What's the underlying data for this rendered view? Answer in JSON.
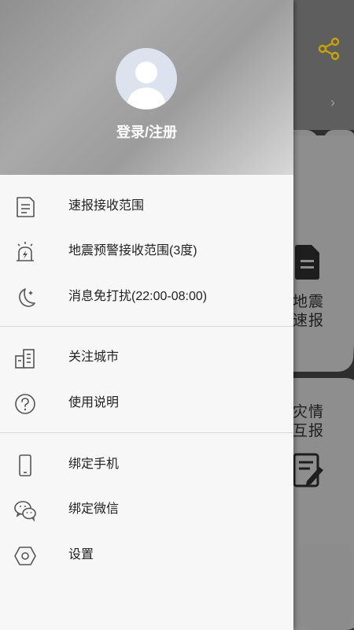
{
  "drawer": {
    "login_label": "登录/注册",
    "menu": [
      {
        "label": "速报接收范围",
        "icon": "document-icon"
      },
      {
        "label": "地震预警接收范围(3度)",
        "icon": "alarm-siren-icon"
      },
      {
        "label": "消息免打扰(22:00-08:00)",
        "icon": "moon-icon"
      },
      {
        "label": "关注城市",
        "icon": "buildings-icon"
      },
      {
        "label": "使用说明",
        "icon": "question-icon"
      },
      {
        "label": "绑定手机",
        "icon": "phone-icon"
      },
      {
        "label": "绑定微信",
        "icon": "wechat-icon"
      },
      {
        "label": "设置",
        "icon": "settings-hexagon-icon"
      }
    ]
  },
  "background": {
    "quake_label": "地震\n速报",
    "disaster_label": "灾情\n互报",
    "share_icon_color": "#c9a300"
  }
}
